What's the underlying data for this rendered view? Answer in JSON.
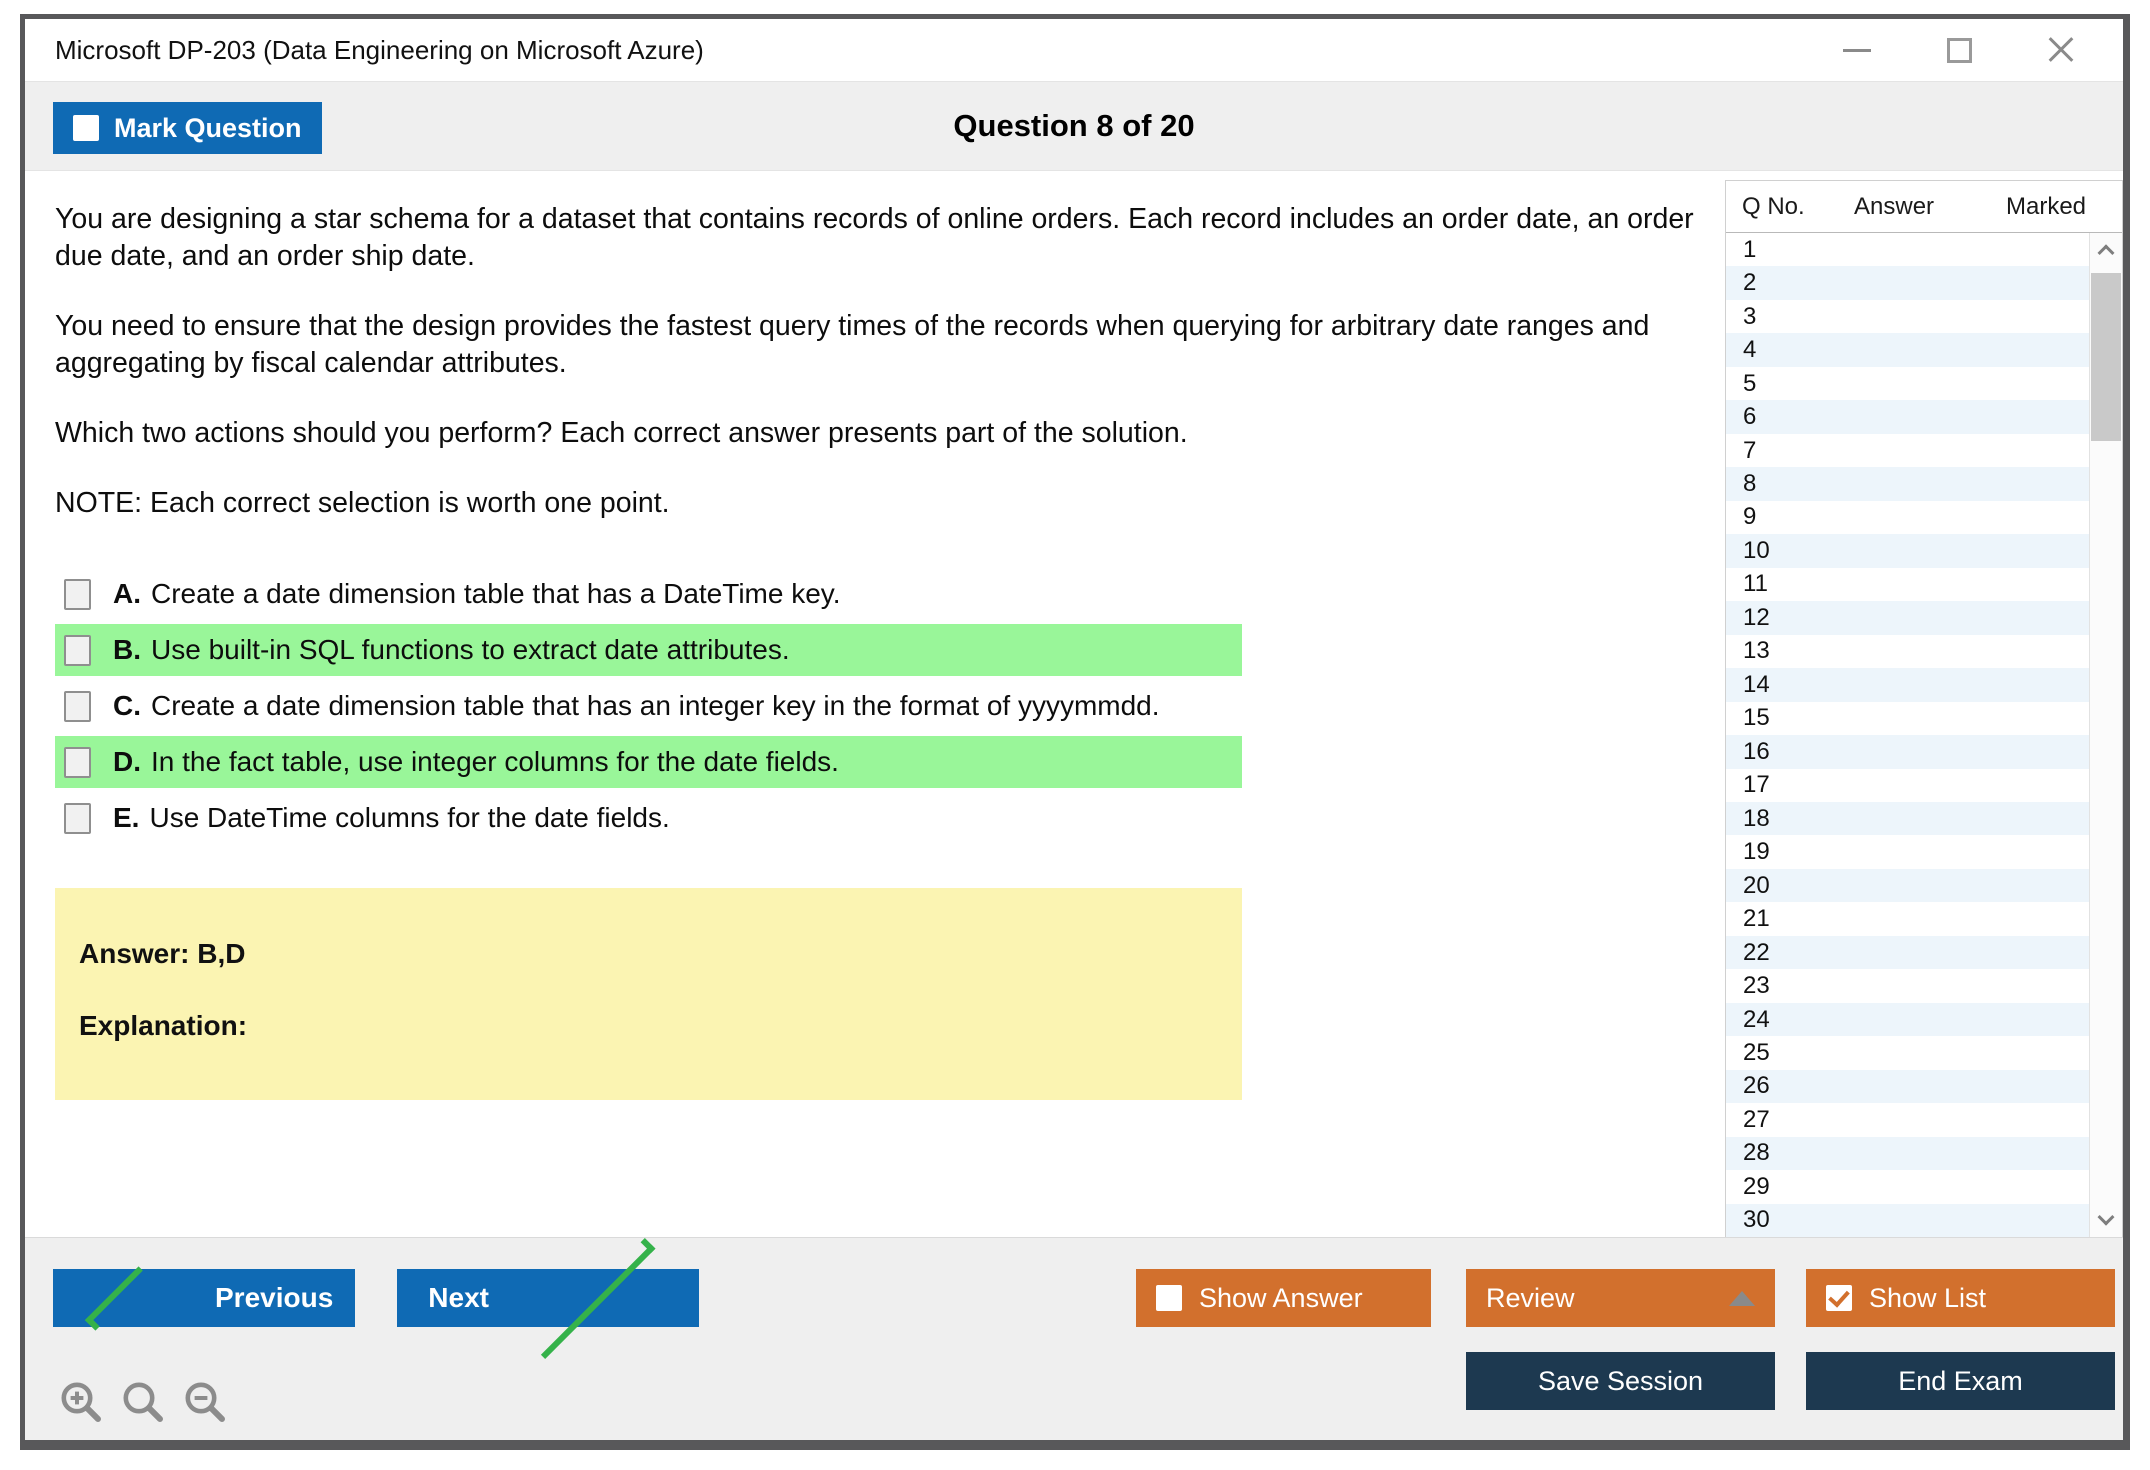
{
  "window": {
    "title": "Microsoft DP-203 (Data Engineering on Microsoft Azure)",
    "controls": [
      "minimize",
      "maximize",
      "close"
    ]
  },
  "header": {
    "mark_question_label": "Mark Question",
    "question_counter": "Question 8 of 20"
  },
  "question": {
    "paragraphs": [
      "You are designing a star schema for a dataset that contains records of online orders. Each record includes an order date, an order due date, and an order ship date.",
      "You need to ensure that the design provides the fastest query times of the records when querying for arbitrary date ranges and aggregating by fiscal calendar attributes.",
      "Which two actions should you perform? Each correct answer presents part of the solution.",
      "NOTE: Each correct selection is worth one point."
    ],
    "options": [
      {
        "letter": "A.",
        "text": "Create a date dimension table that has a DateTime key.",
        "highlighted": false,
        "checked": false
      },
      {
        "letter": "B.",
        "text": "Use built-in SQL functions to extract date attributes.",
        "highlighted": true,
        "checked": false
      },
      {
        "letter": "C.",
        "text": "Create a date dimension table that has an integer key in the format of yyyymmdd.",
        "highlighted": false,
        "checked": false
      },
      {
        "letter": "D.",
        "text": "In the fact table, use integer columns for the date fields.",
        "highlighted": true,
        "checked": false
      },
      {
        "letter": "E.",
        "text": "Use DateTime columns for the date fields.",
        "highlighted": false,
        "checked": false
      }
    ],
    "answer_label": "Answer: B,D",
    "explanation_label": "Explanation:"
  },
  "sidebar": {
    "columns": [
      "Q No.",
      "Answer",
      "Marked"
    ],
    "rows": [
      {
        "q": "1",
        "answer": "",
        "marked": ""
      },
      {
        "q": "2",
        "answer": "",
        "marked": ""
      },
      {
        "q": "3",
        "answer": "",
        "marked": ""
      },
      {
        "q": "4",
        "answer": "",
        "marked": ""
      },
      {
        "q": "5",
        "answer": "",
        "marked": ""
      },
      {
        "q": "6",
        "answer": "",
        "marked": ""
      },
      {
        "q": "7",
        "answer": "",
        "marked": ""
      },
      {
        "q": "8",
        "answer": "",
        "marked": ""
      },
      {
        "q": "9",
        "answer": "",
        "marked": ""
      },
      {
        "q": "10",
        "answer": "",
        "marked": ""
      },
      {
        "q": "11",
        "answer": "",
        "marked": ""
      },
      {
        "q": "12",
        "answer": "",
        "marked": ""
      },
      {
        "q": "13",
        "answer": "",
        "marked": ""
      },
      {
        "q": "14",
        "answer": "",
        "marked": ""
      },
      {
        "q": "15",
        "answer": "",
        "marked": ""
      },
      {
        "q": "16",
        "answer": "",
        "marked": ""
      },
      {
        "q": "17",
        "answer": "",
        "marked": ""
      },
      {
        "q": "18",
        "answer": "",
        "marked": ""
      },
      {
        "q": "19",
        "answer": "",
        "marked": ""
      },
      {
        "q": "20",
        "answer": "",
        "marked": ""
      },
      {
        "q": "21",
        "answer": "",
        "marked": ""
      },
      {
        "q": "22",
        "answer": "",
        "marked": ""
      },
      {
        "q": "23",
        "answer": "",
        "marked": ""
      },
      {
        "q": "24",
        "answer": "",
        "marked": ""
      },
      {
        "q": "25",
        "answer": "",
        "marked": ""
      },
      {
        "q": "26",
        "answer": "",
        "marked": ""
      },
      {
        "q": "27",
        "answer": "",
        "marked": ""
      },
      {
        "q": "28",
        "answer": "",
        "marked": ""
      },
      {
        "q": "29",
        "answer": "",
        "marked": ""
      },
      {
        "q": "30",
        "answer": "",
        "marked": ""
      }
    ],
    "scrollbar_icons": [
      "scroll-up",
      "scroll-down"
    ]
  },
  "footer": {
    "previous_label": "Previous",
    "next_label": "Next",
    "show_answer_label": "Show Answer",
    "review_label": "Review",
    "show_list_label": "Show List",
    "save_session_label": "Save Session",
    "end_exam_label": "End Exam",
    "zoom_icons": [
      "magnifier-plus",
      "magnifier",
      "magnifier-minus"
    ]
  },
  "colors": {
    "accent_blue": "#0f6ab4",
    "accent_orange": "#d2702d",
    "navy": "#1d3950",
    "highlight_green": "#99f699",
    "answer_yellow": "#fbf4b2",
    "band_gray": "#efefef",
    "row_alt_blue": "#edf5fb",
    "nav_chevron_green": "#35b24a"
  }
}
